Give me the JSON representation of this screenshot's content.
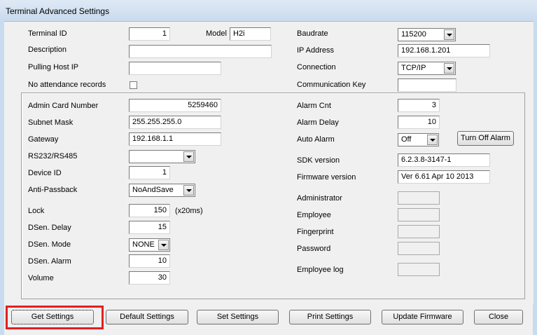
{
  "window": {
    "title": "Terminal Advanced Settings"
  },
  "top": {
    "terminal_id_label": "Terminal ID",
    "terminal_id_value": "1",
    "model_label": "Model",
    "model_value": "H2i",
    "description_label": "Description",
    "description_value": "",
    "pulling_host_ip_label": "Pulling Host IP",
    "pulling_host_ip_value": "",
    "no_attendance_label": "No attendance records",
    "no_attendance_checked": false,
    "baudrate_label": "Baudrate",
    "baudrate_value": "115200",
    "ip_address_label": "IP Address",
    "ip_address_value": "192.168.1.201",
    "connection_label": "Connection",
    "connection_value": "TCP/IP",
    "comm_key_label": "Communication Key",
    "comm_key_value": ""
  },
  "group": {
    "admin_card_label": "Admin Card Number",
    "admin_card_value": "5259460",
    "subnet_label": "Subnet Mask",
    "subnet_value": "255.255.255.0",
    "gateway_label": "Gateway",
    "gateway_value": "192.168.1.1",
    "rs_label": "RS232/RS485",
    "rs_value": "",
    "device_id_label": "Device ID",
    "device_id_value": "1",
    "antipassback_label": "Anti-Passback",
    "antipassback_value": "NoAndSave",
    "lock_label": "Lock",
    "lock_value": "150",
    "lock_unit": "(x20ms)",
    "dsen_delay_label": "DSen. Delay",
    "dsen_delay_value": "15",
    "dsen_mode_label": "DSen. Mode",
    "dsen_mode_value": "NONE",
    "dsen_alarm_label": "DSen. Alarm",
    "dsen_alarm_value": "10",
    "volume_label": "Volume",
    "volume_value": "30",
    "alarm_cnt_label": "Alarm Cnt",
    "alarm_cnt_value": "3",
    "alarm_delay_label": "Alarm Delay",
    "alarm_delay_value": "10",
    "auto_alarm_label": "Auto Alarm",
    "auto_alarm_value": "Off",
    "turn_off_alarm_label": "Turn Off Alarm",
    "sdk_version_label": "SDK version",
    "sdk_version_value": "6.2.3.8-3147-1",
    "firmware_version_label": "Firmware version",
    "firmware_version_value": "Ver 6.61 Apr 10 2013",
    "administrator_label": "Administrator",
    "administrator_value": "",
    "employee_label": "Employee",
    "employee_value": "",
    "fingerprint_label": "Fingerprint",
    "fingerprint_value": "",
    "password_label": "Password",
    "password_value": "",
    "employee_log_label": "Employee log",
    "employee_log_value": ""
  },
  "buttons": {
    "get_settings": "Get Settings",
    "default_settings": "Default Settings",
    "set_settings": "Set Settings",
    "print_settings": "Print Settings",
    "update_firmware": "Update Firmware",
    "close": "Close"
  },
  "colors": {
    "highlight": "#e02020",
    "titlebar": "#c9dbee"
  }
}
